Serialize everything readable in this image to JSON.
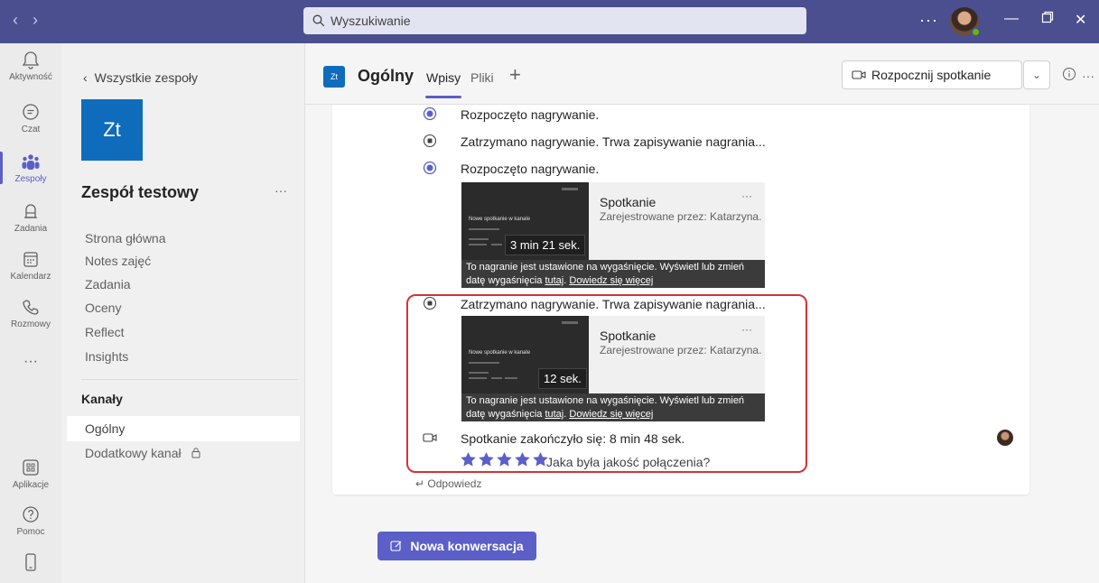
{
  "titlebar": {
    "search_placeholder": "Wyszukiwanie",
    "more": "···"
  },
  "rail": {
    "items": [
      {
        "label": "Aktywność",
        "icon": "bell-icon"
      },
      {
        "label": "Czat",
        "icon": "chat-icon"
      },
      {
        "label": "Zespoły",
        "icon": "teams-icon"
      },
      {
        "label": "Zadania",
        "icon": "tasks-icon"
      },
      {
        "label": "Kalendarz",
        "icon": "calendar-icon"
      },
      {
        "label": "Rozmowy",
        "icon": "phone-icon"
      },
      {
        "label": "···",
        "icon": "more-icon"
      },
      {
        "label": "Aplikacje",
        "icon": "apps-icon"
      },
      {
        "label": "Pomoc",
        "icon": "help-icon"
      }
    ]
  },
  "team_panel": {
    "back": "Wszystkie zespoły",
    "logo_text": "Zt",
    "team_name": "Zespół testowy",
    "more": "···",
    "links": [
      "Strona główna",
      "Notes zajęć",
      "Zadania",
      "Oceny",
      "Reflect",
      "Insights"
    ],
    "channels_heading": "Kanały",
    "channels": [
      "Ogólny",
      "Dodatkowy kanał"
    ]
  },
  "header": {
    "badge": "Zt",
    "channel_name": "Ogólny",
    "tabs": [
      "Wpisy",
      "Pliki"
    ],
    "add_tab": "+",
    "meet_label": "Rozpocznij spotkanie",
    "more": "···"
  },
  "events": {
    "rec_started": "Rozpoczęto nagrywanie.",
    "rec_stopped": "Zatrzymano nagrywanie. Trwa zapisywanie nagrania...",
    "meeting_ended": "Spotkanie zakończyło się: 8 min 48 sek."
  },
  "recordings": [
    {
      "thumb_title": "Nowe spotkanie w kanale",
      "duration": "3 min 21 sek.",
      "name": "Spotkanie",
      "by": "Zarejestrowane przez: Katarzyna...",
      "more": "···",
      "note_a": "To nagranie jest ustawione na wygaśnięcie. Wyświetl lub zmień",
      "note_b": "datę wygaśnięcia",
      "note_link1": "tutaj",
      "note_link2": "Dowiedz się więcej"
    },
    {
      "thumb_title": "Nowe spotkanie w kanale",
      "duration": "12 sek.",
      "name": "Spotkanie",
      "by": "Zarejestrowane przez: Katarzyna...",
      "more": "···",
      "note_a": "To nagranie jest ustawione na wygaśnięcie. Wyświetl lub zmień",
      "note_b": "datę wygaśnięcia",
      "note_link1": "tutaj",
      "note_link2": "Dowiedz się więcej"
    }
  ],
  "rating": {
    "stars": 5,
    "question": "Jaka była jakość połączenia?"
  },
  "reply": "Odpowiedz",
  "new_conversation": "Nowa konwersacja",
  "colors": {
    "titlebar": "#4b4f8f",
    "accent": "#5b5fc7",
    "team_tile": "#0f6cbd",
    "highlight": "#d13438"
  }
}
